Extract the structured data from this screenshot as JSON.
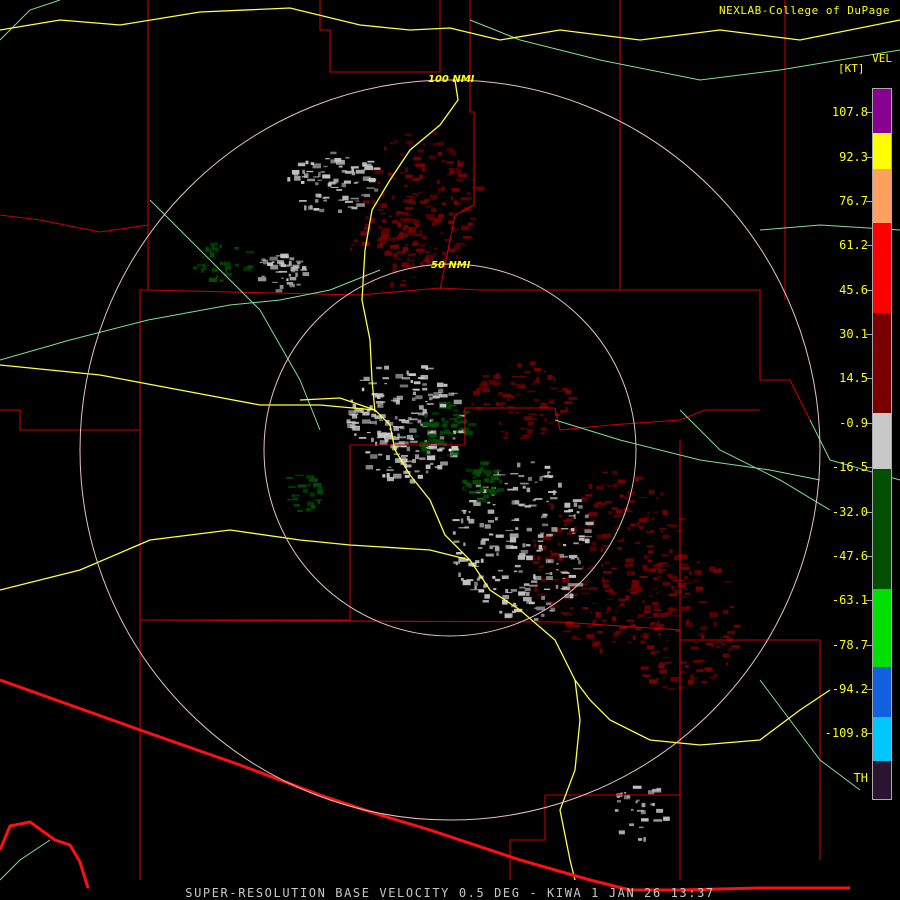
{
  "header": {
    "credit": "NEXLAB-College of DuPage"
  },
  "legend": {
    "product": "VEL",
    "unit": "[KT]",
    "labels": [
      "107.8",
      "92.3",
      "76.7",
      "61.2",
      "45.6",
      "30.1",
      "14.5",
      "-0.9",
      "-16.5",
      "-32.0",
      "-47.6",
      "-63.1",
      "-78.7",
      "-94.2",
      "-109.8",
      "TH"
    ],
    "colors": {
      "purple": "#8a0090",
      "yellow": "#ffff00",
      "orange": "#ffa060",
      "red": "#ff0000",
      "darkred": "#7a0000",
      "gray": "#c8c8c8",
      "darkgreen": "#005000",
      "green": "#00e000",
      "blue": "#1060e0",
      "cyan": "#00c8ff",
      "th": "#2a1530"
    }
  },
  "map": {
    "range_rings": [
      "100 NMI",
      "50 NMI"
    ],
    "colors": {
      "county_lines": "#c80000",
      "highways": "#ffff40",
      "rivers_roads": "#80e090",
      "border": "#ff1010",
      "rings": "#e8c0c0"
    }
  },
  "footer": {
    "product_line": "SUPER-RESOLUTION BASE VELOCITY 0.5 DEG - KIWA 1 JAN 26 13:37"
  }
}
